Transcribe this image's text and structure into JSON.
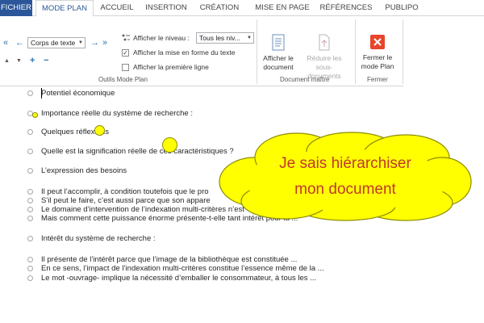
{
  "tabs": [
    "FICHIER",
    "MODE PLAN",
    "ACCUEIL",
    "INSERTION",
    "CRÉATION",
    "MISE EN PAGE",
    "RÉFÉRENCES",
    "PUBLIPO"
  ],
  "ribbon": {
    "outline_tools": {
      "level_dropdown": "Corps de texte",
      "show_level_label": "Afficher le niveau :",
      "show_level_value": "Tous les niv...",
      "show_formatting": "Afficher la mise en forme du texte",
      "show_first_line": "Afficher la première ligne",
      "show_formatting_checked": true,
      "show_first_line_checked": false,
      "group_label": "Outils Mode Plan"
    },
    "master_document": {
      "show_document_line1": "Afficher le",
      "show_document_line2": "document",
      "collapse_line1": "Réduire les sous-",
      "collapse_line2": "documents",
      "group_label": "Document maître"
    },
    "close": {
      "close_line1": "Fermer le",
      "close_line2": "mode Plan",
      "group_label": "Fermer"
    },
    "accent_color": "#2b579a",
    "close_color": "#e8452c"
  },
  "document": {
    "lines": [
      "Potentiel économique",
      "Importance réelle du système de recherche :",
      "Quelques réflexions",
      "Quelle est la signification réelle de ces caractéristiques ?",
      "L’expression des besoins",
      "Il peut l’accomplir, à condition toutefois que le pro",
      "S’il peut le faire, c’est aussi parce que son appare",
      "Le domaine d’intervention de l’indexation multi-critères n’est",
      "Mais comment cette puissance énorme présente-t-elle tant intérêt pour la ...",
      "Intérêt du système de recherche :",
      "Il présente de l’intérêt parce que l’image de la bibliothèque est constituée ...",
      "En ce sens, l’impact de l’indexation multi-critères constitue l’essence même de la ...",
      "Le mot  -ouvrage-  implique la nécessité d’emballer  le consommateur, à tous les ..."
    ]
  },
  "callout": {
    "line1": "Je sais hiérarchiser",
    "line2": "mon document",
    "fill_color": "#ffff00",
    "text_color": "#c0392b"
  }
}
